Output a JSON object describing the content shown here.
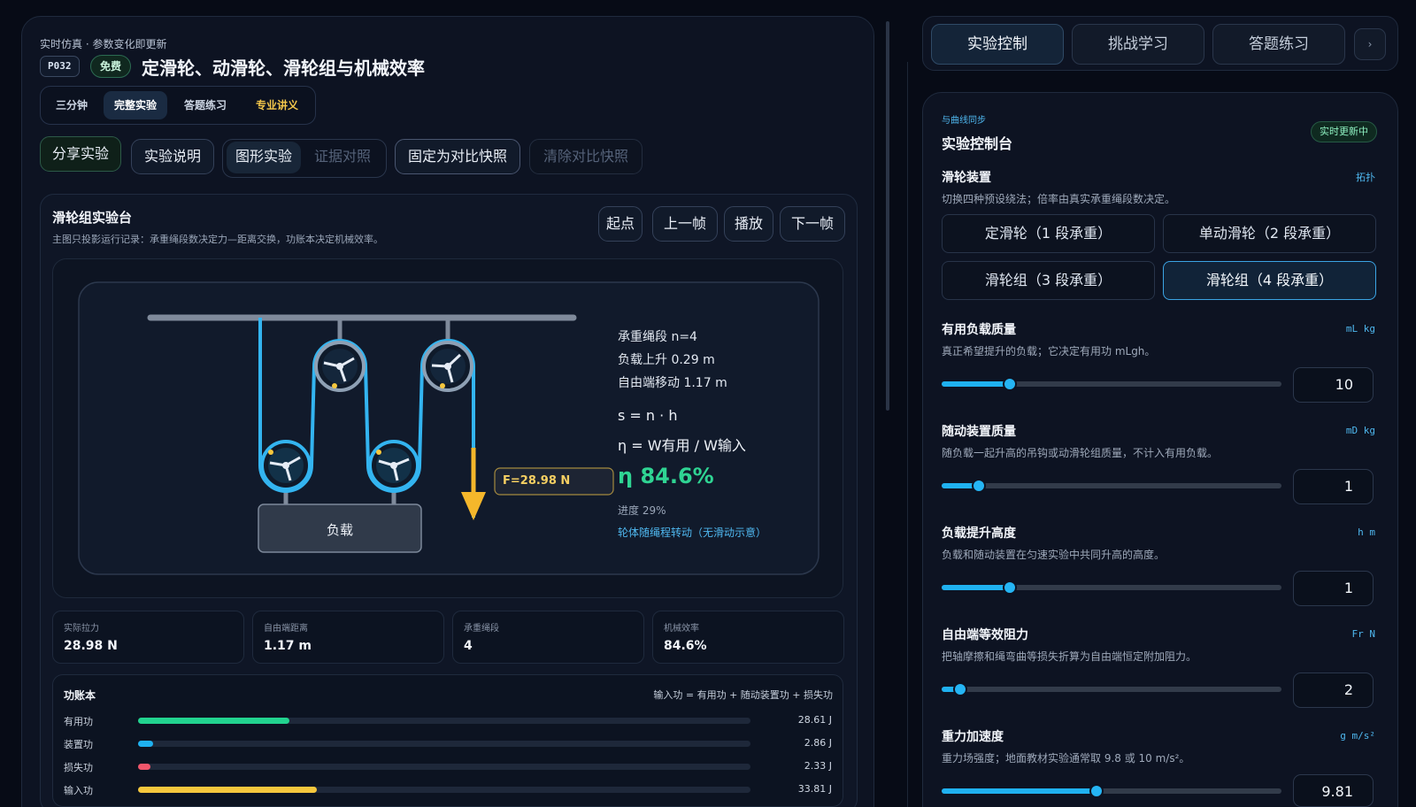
{
  "header": {
    "eyebrow": "实时仿真 · 参数变化即更新",
    "code": "P032",
    "badge": "免费",
    "title": "定滑轮、动滑轮、滑轮组与机械效率"
  },
  "modes": [
    {
      "label": "三分钟"
    },
    {
      "label": "完整实验"
    },
    {
      "label": "答题练习"
    },
    {
      "label": "专业讲义"
    }
  ],
  "toolbar": {
    "share": "分享实验",
    "notes": "实验说明",
    "graph": "图形实验",
    "evidence": "证据对照",
    "pin": "固定为对比快照",
    "clear": "清除对比快照"
  },
  "stage": {
    "title": "滑轮组实验台",
    "subtitle": "主图只投影运行记录：承重绳段数决定力—距离交换，功账本决定机械效率。",
    "controls": [
      "起点",
      "上一帧",
      "播放",
      "下一帧"
    ],
    "load_label": "负载",
    "force_label": "F=28.98 N",
    "readout": {
      "segments": "承重绳段 n=4",
      "load_rise": "负载上升 0.29 m",
      "free_end": "自由端移动 1.17 m",
      "formula1": "s = n · h",
      "formula2": "η = W有用 / W输入",
      "efficiency": "η 84.6%",
      "progress": "进度 29%",
      "note": "轮体随绳程转动（无滑动示意）"
    }
  },
  "stats": [
    {
      "label": "实际拉力",
      "value": "28.98 N"
    },
    {
      "label": "自由端距离",
      "value": "1.17 m"
    },
    {
      "label": "承重绳段",
      "value": "4"
    },
    {
      "label": "机械效率",
      "value": "84.6%"
    }
  ],
  "ledger": {
    "title": "功账本",
    "formula": "输入功 = 有用功 + 随动装置功 + 损失功",
    "rows": [
      {
        "label": "有用功",
        "value": "28.61 J",
        "fraction": 0.2475,
        "color": "#22d38f"
      },
      {
        "label": "装置功",
        "value": "2.86 J",
        "fraction": 0.0247,
        "color": "#1fb1f0"
      },
      {
        "label": "损失功",
        "value": "2.33 J",
        "fraction": 0.0201,
        "color": "#f0566b"
      },
      {
        "label": "输入功",
        "value": "33.81 J",
        "fraction": 0.2923,
        "color": "#f5c73d"
      }
    ]
  },
  "right_tabs": [
    {
      "label": "实验控制"
    },
    {
      "label": "挑战学习"
    },
    {
      "label": "答题练习"
    }
  ],
  "right_more": "›",
  "console": {
    "eyebrow": "与曲线同步",
    "title": "实验控制台",
    "live": "实时更新中",
    "pulley": {
      "title": "滑轮装置",
      "unit": "拓扑",
      "desc": "切换四种预设绕法；倍率由真实承重绳段数决定。",
      "presets": [
        "定滑轮（1 段承重）",
        "单动滑轮（2 段承重）",
        "滑轮组（3 段承重）",
        "滑轮组（4 段承重）"
      ]
    },
    "sliders": [
      {
        "title": "有用负载质量",
        "unit": "mL kg",
        "desc": "真正希望提升的负载；它决定有用功 mLgh。",
        "value": "10",
        "fraction": 0.2
      },
      {
        "title": "随动装置质量",
        "unit": "mD kg",
        "desc": "随负载一起升高的吊钩或动滑轮组质量，不计入有用负载。",
        "value": "1",
        "fraction": 0.11
      },
      {
        "title": "负载提升高度",
        "unit": "h m",
        "desc": "负载和随动装置在匀速实验中共同升高的高度。",
        "value": "1",
        "fraction": 0.2
      },
      {
        "title": "自由端等效阻力",
        "unit": "Fr N",
        "desc": "把轴摩擦和绳弯曲等损失折算为自由端恒定附加阻力。",
        "value": "2",
        "fraction": 0.055
      },
      {
        "title": "重力加速度",
        "unit": "g m/s²",
        "desc": "重力场强度；地面教材实验通常取 9.8 或 10 m/s²。",
        "value": "9.81",
        "fraction": 0.455
      }
    ]
  }
}
